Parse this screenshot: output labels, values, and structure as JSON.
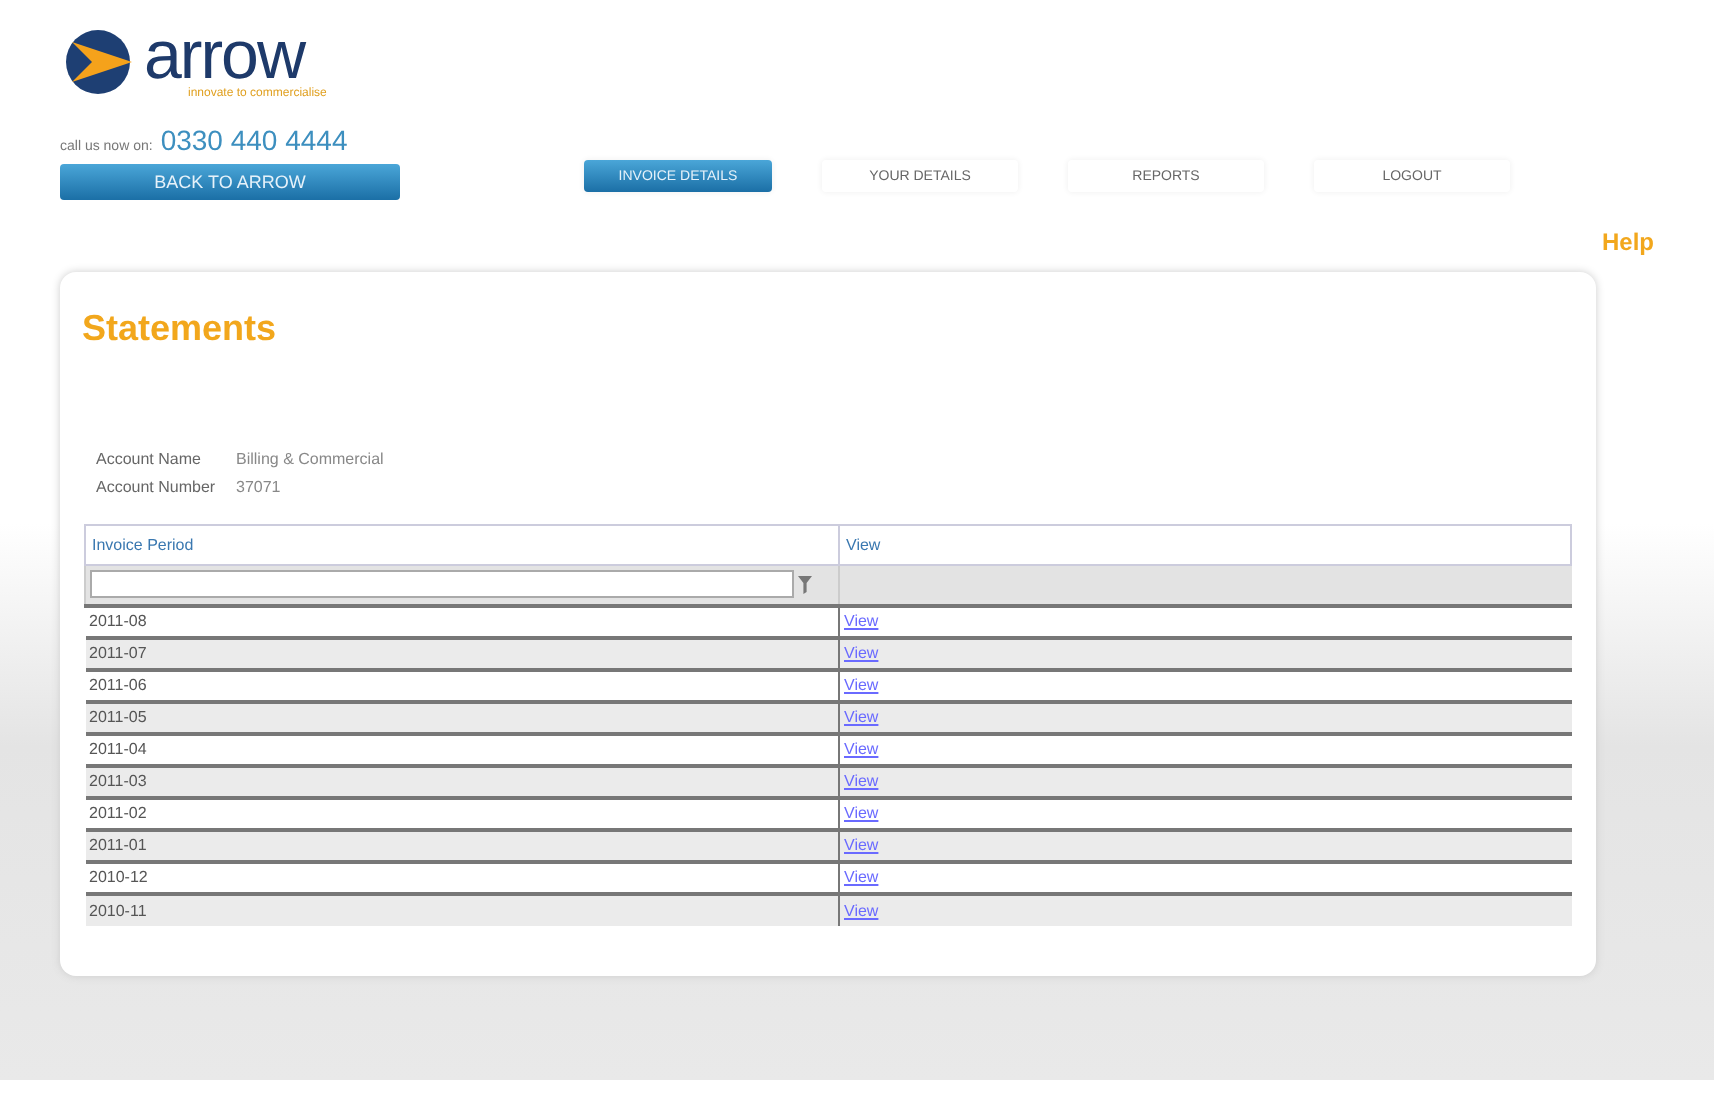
{
  "logo": {
    "name": "arrow",
    "tagline": "innovate to commercialise"
  },
  "call": {
    "label": "call us now on:",
    "phone": "0330 440 4444"
  },
  "back_button": "BACK TO ARROW",
  "nav": [
    {
      "label": "INVOICE DETAILS",
      "selected": true
    },
    {
      "label": "YOUR DETAILS",
      "selected": false
    },
    {
      "label": "REPORTS",
      "selected": false
    },
    {
      "label": "LOGOUT",
      "selected": false
    }
  ],
  "help": "Help",
  "title": "Statements",
  "account": [
    {
      "label": "Account Name",
      "value": "Billing & Commercial"
    },
    {
      "label": "Account Number",
      "value": "37071"
    }
  ],
  "table": {
    "columns": [
      "Invoice Period",
      "View"
    ],
    "rows": [
      {
        "period": "2011-08",
        "link": "View"
      },
      {
        "period": "2011-07",
        "link": "View"
      },
      {
        "period": "2011-06",
        "link": "View"
      },
      {
        "period": "2011-05",
        "link": "View"
      },
      {
        "period": "2011-04",
        "link": "View"
      },
      {
        "period": "2011-03",
        "link": "View"
      },
      {
        "period": "2011-02",
        "link": "View"
      },
      {
        "period": "2011-01",
        "link": "View"
      },
      {
        "period": "2010-12",
        "link": "View"
      },
      {
        "period": "2010-11",
        "link": "View"
      }
    ]
  }
}
